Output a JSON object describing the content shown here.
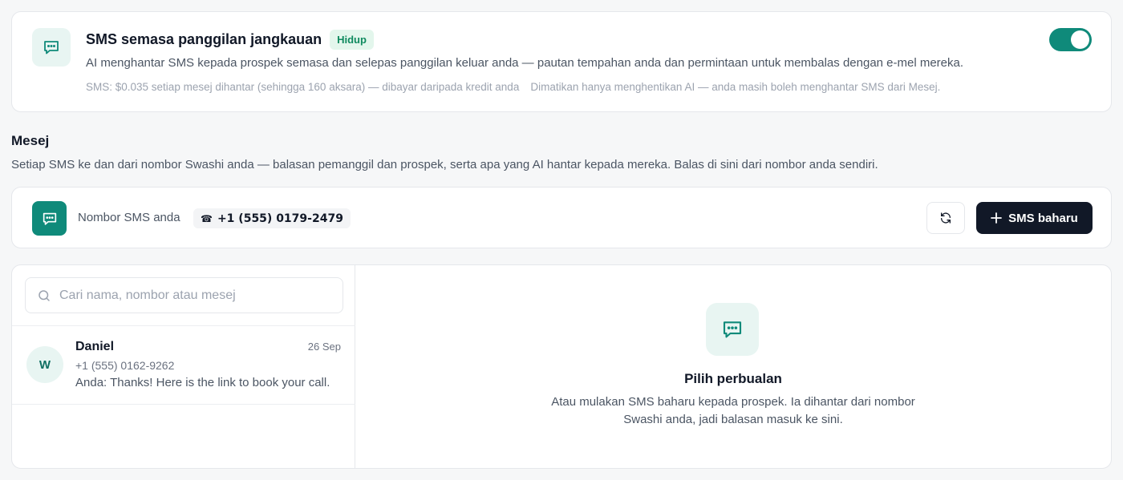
{
  "feature": {
    "title": "SMS semasa panggilan jangkauan",
    "status_badge": "Hidup",
    "description": "AI menghantar SMS kepada prospek semasa dan selepas panggilan keluar anda — pautan tempahan anda dan permintaan untuk membalas dengan e-mel mereka.",
    "pricing_note": "SMS: $0.035 setiap mesej dihantar (sehingga 160 aksara) — dibayar daripada kredit anda",
    "off_note": "Dimatikan hanya menghentikan AI — anda masih boleh menghantar SMS dari Mesej.",
    "toggle_on": true,
    "icon": "chat-bubble-icon"
  },
  "messages_section": {
    "title": "Mesej",
    "description": "Setiap SMS ke dan dari nombor Swashi anda — balasan pemanggil dan prospek, serta apa yang AI hantar kepada mereka. Balas di sini dari nombor anda sendiri."
  },
  "number_bar": {
    "label": "Nombor SMS anda",
    "phone_icon": "☎",
    "phone_number": "+1 (555) 0179-2479",
    "refresh_icon": "refresh-icon",
    "new_sms_label": "SMS baharu"
  },
  "search": {
    "placeholder": "Cari nama, nombor atau mesej",
    "value": ""
  },
  "conversations": [
    {
      "avatar_initial": "W",
      "name": "Daniel",
      "date": "26 Sep",
      "number": "+1 (555) 0162-9262",
      "preview": "Anda: Thanks! Here is the link to book your call."
    }
  ],
  "empty_state": {
    "title": "Pilih perbualan",
    "description": "Atau mulakan SMS baharu kepada prospek. Ia dihantar dari nombor Swashi anda, jadi balasan masuk ke sini."
  },
  "colors": {
    "accent": "#0f8a7a",
    "accent_soft": "#e8f5f2",
    "badge_text": "#0f8a5f",
    "badge_bg": "#e3f6ec",
    "primary_button": "#111827"
  }
}
